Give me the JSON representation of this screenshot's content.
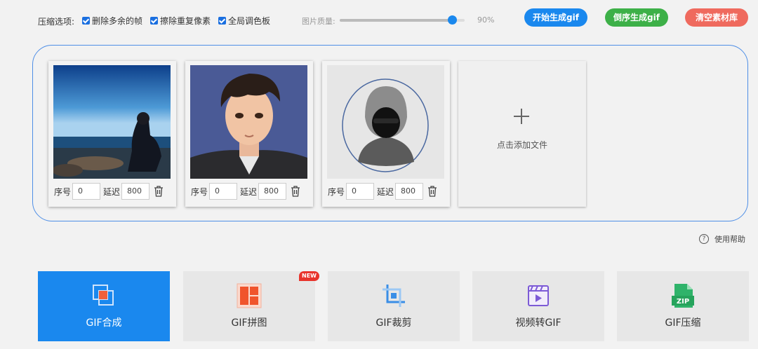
{
  "toolbar": {
    "compress_label": "压缩选项:",
    "options": [
      {
        "label": "删除多余的帧",
        "checked": true
      },
      {
        "label": "擦除重复像素",
        "checked": true
      },
      {
        "label": "全局调色板",
        "checked": true
      }
    ],
    "quality_label": "图片质量:",
    "quality_value": "90%",
    "quality_fraction": 0.9,
    "start_button": "开始生成gif",
    "reverse_button": "倒序生成gif",
    "clear_button": "清空素材库"
  },
  "frames": [
    {
      "order_label": "序号",
      "order": "0",
      "delay_label": "延迟",
      "delay": "800",
      "image": "man-sitting-by-sea"
    },
    {
      "order_label": "序号",
      "order": "0",
      "delay_label": "延迟",
      "delay": "800",
      "image": "anime-boy-portrait"
    },
    {
      "order_label": "序号",
      "order": "0",
      "delay_label": "延迟",
      "delay": "800",
      "image": "hooded-figure-avatar"
    }
  ],
  "add_file_label": "点击添加文件",
  "help_label": "使用帮助",
  "tabs": [
    {
      "label": "GIF合成",
      "icon": "gif-compose-icon",
      "active": true
    },
    {
      "label": "GIF拼图",
      "icon": "gif-collage-icon",
      "active": false,
      "badge": "NEW"
    },
    {
      "label": "GIF裁剪",
      "icon": "crop-icon",
      "active": false
    },
    {
      "label": "视频转GIF",
      "icon": "video-to-gif-icon",
      "active": false
    },
    {
      "label": "GIF压缩",
      "icon": "zip-icon",
      "active": false
    }
  ],
  "colors": {
    "accent": "#1a88ee",
    "green": "#3db048",
    "red": "#ef6a5e",
    "panel_border": "#4e8ee6"
  }
}
